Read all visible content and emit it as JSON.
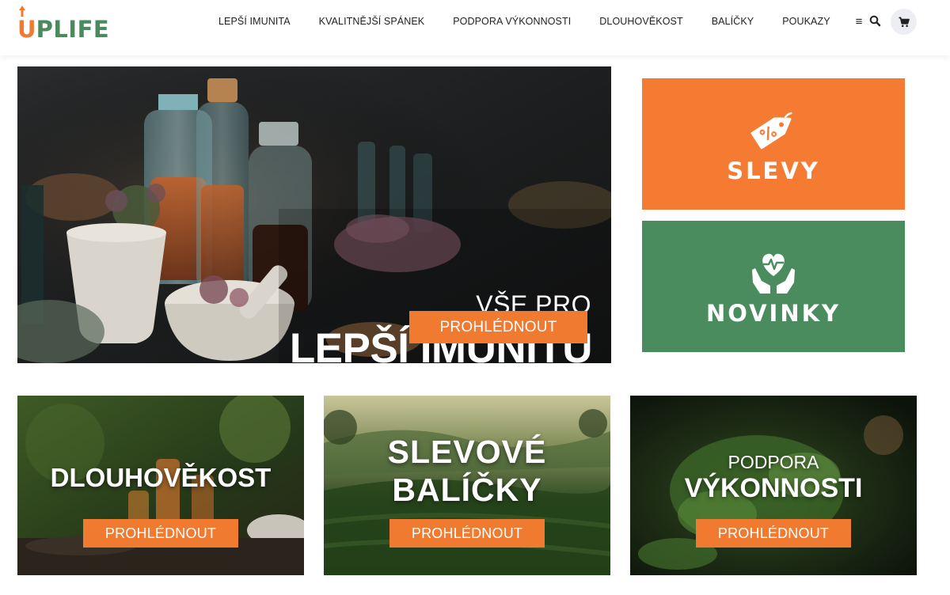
{
  "header": {
    "logo": "UPLIFE",
    "logo_first": "U",
    "logo_rest": "PLIFE",
    "nav": [
      {
        "label": "LEPŠÍ IMUNITA"
      },
      {
        "label": "KVALITNĚJŠÍ SPÁNEK"
      },
      {
        "label": "PODPORA VÝKONNOSTI"
      },
      {
        "label": "DLOUHOVĚKOST"
      },
      {
        "label": "BALÍČKY"
      },
      {
        "label": "POUKAZY"
      }
    ],
    "menu_glyph": "≡",
    "search_icon": "search-icon",
    "cart_icon": "cart-icon"
  },
  "hero": {
    "subtitle": "VŠE PRO",
    "title": "LEPŠÍ IMUNITU",
    "cta": "PROHLÉDNOUT"
  },
  "promos": {
    "sale": {
      "label": "SLEVY",
      "icon": "discount-tag-icon",
      "color": "#f47b31"
    },
    "new": {
      "label": "NOVINKY",
      "icon": "heart-hands-icon",
      "color": "#4b8c5f"
    }
  },
  "cards": [
    {
      "title": "DLOUHOVĚKOST",
      "cta": "PROHLÉDNOUT"
    },
    {
      "title_line1": "SLEVOVÉ",
      "title_line2": "BALÍČKY",
      "cta": "PROHLÉDNOUT"
    },
    {
      "sub": "PODPORA",
      "title": "VÝKONNOSTI",
      "cta": "PROHLÉDNOUT"
    }
  ],
  "colors": {
    "accent_orange": "#f07a30",
    "brand_green": "#4a8a5c"
  }
}
